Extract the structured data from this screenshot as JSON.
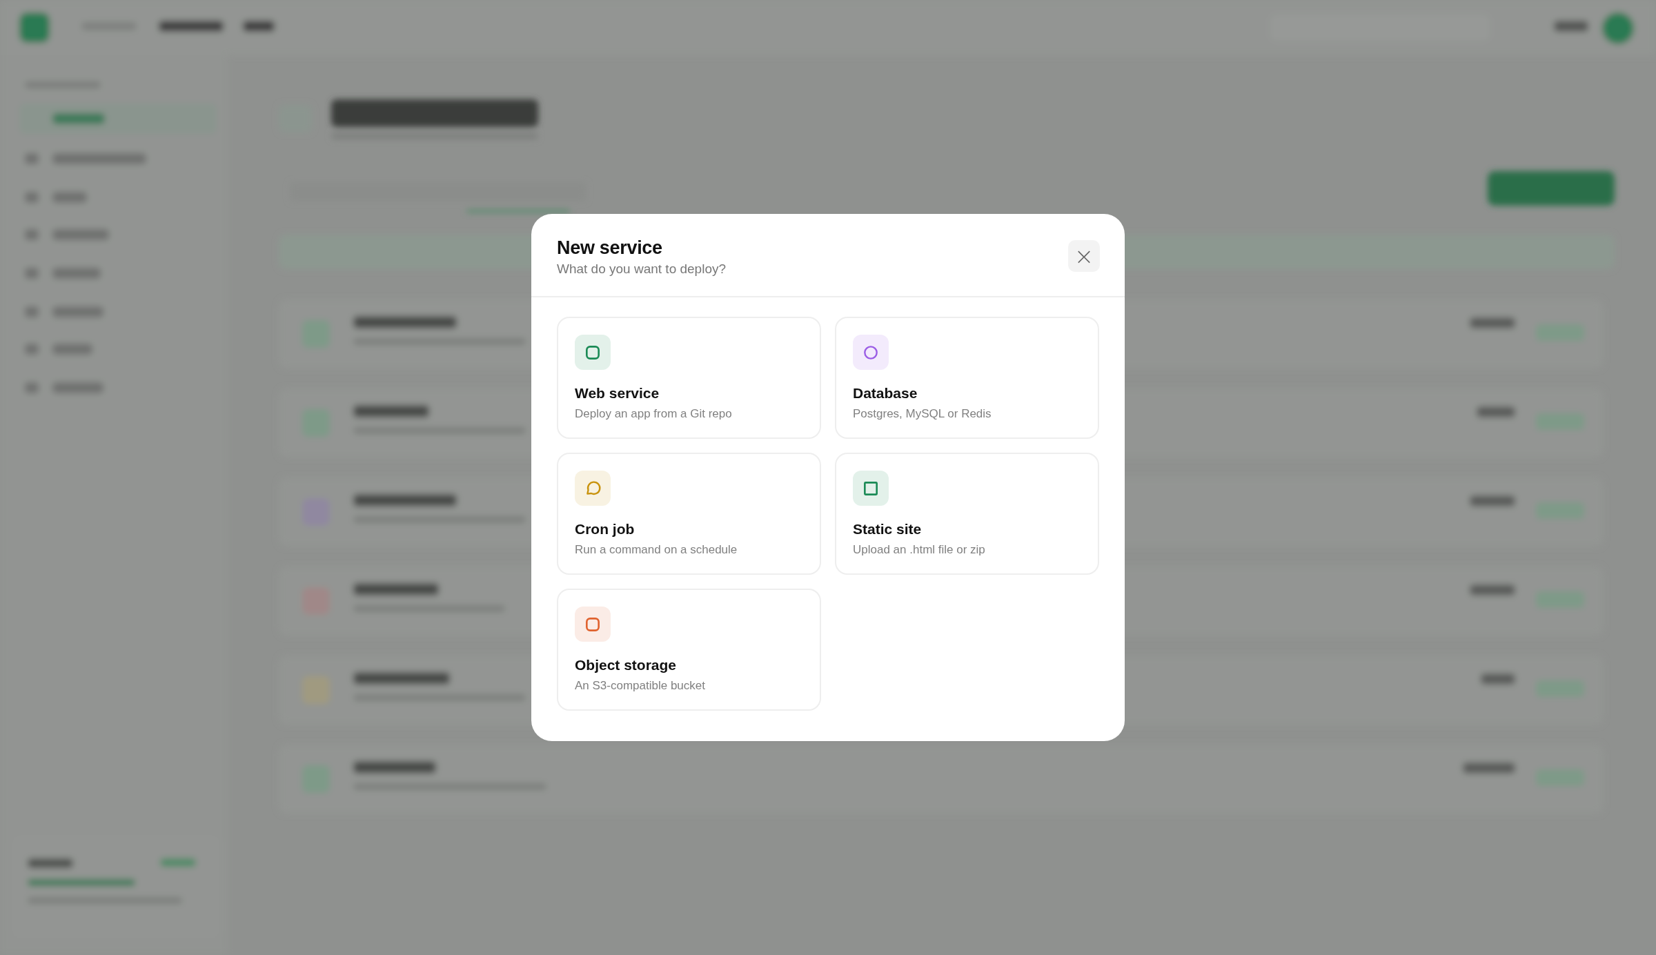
{
  "dialog": {
    "title": "New service",
    "subtitle": "What do you want to deploy?",
    "close_icon": "×",
    "options": [
      {
        "title": "Web service",
        "description": "Deploy an app from a Git repo",
        "kind": "rounded-square",
        "color": "#1a8a55"
      },
      {
        "title": "Database",
        "description": "Postgres, MySQL or Redis",
        "kind": "circle",
        "color": "#9b5de5"
      },
      {
        "title": "Cron job",
        "description": "Run a command on a schedule",
        "kind": "bubble",
        "color": "#c9930e"
      },
      {
        "title": "Static site",
        "description": "Upload an .html file or zip",
        "kind": "square",
        "color": "#1a8a55"
      },
      {
        "title": "Object storage",
        "description": "An S3-compatible bucket",
        "kind": "rounded-square",
        "color": "#e0622e"
      }
    ]
  }
}
